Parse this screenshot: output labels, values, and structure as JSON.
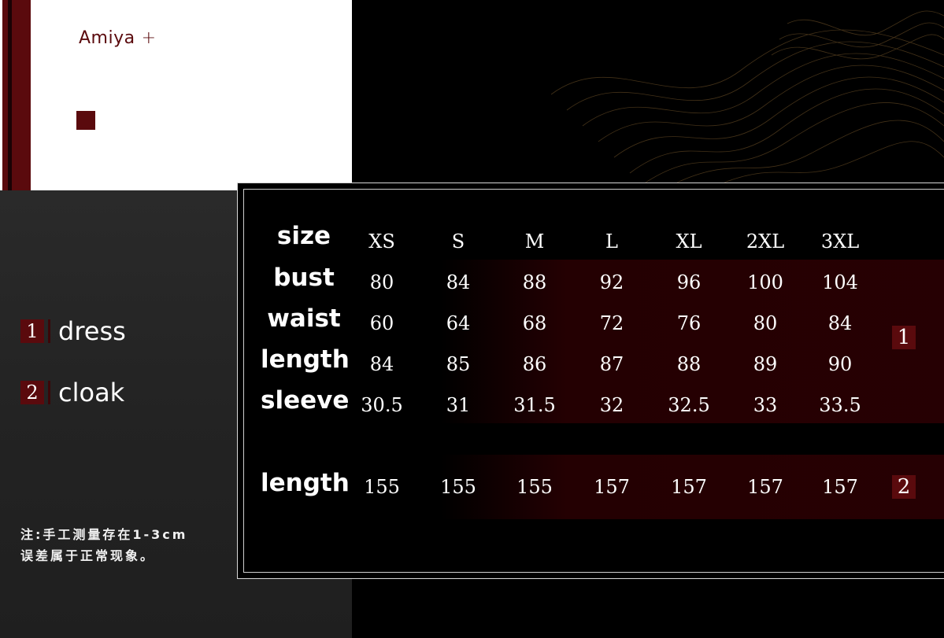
{
  "brand": {
    "name": "Amiya",
    "plus": "+"
  },
  "legend": [
    {
      "num": "1",
      "label": "dress"
    },
    {
      "num": "2",
      "label": "cloak"
    }
  ],
  "note": {
    "line1": "注:手工测量存在1-3cm",
    "line2": "误差属于正常现象。"
  },
  "table": {
    "header_label": "size",
    "sizes": [
      "XS",
      "S",
      "M",
      "L",
      "XL",
      "2XL",
      "3XL"
    ],
    "rows": [
      {
        "label": "bust",
        "values": [
          "80",
          "84",
          "88",
          "92",
          "96",
          "100",
          "104"
        ]
      },
      {
        "label": "waist",
        "values": [
          "60",
          "64",
          "68",
          "72",
          "76",
          "80",
          "84"
        ]
      },
      {
        "label": "length",
        "values": [
          "84",
          "85",
          "86",
          "87",
          "88",
          "89",
          "90"
        ]
      },
      {
        "label": "sleeve",
        "values": [
          "30.5",
          "31",
          "31.5",
          "32",
          "32.5",
          "33",
          "33.5"
        ]
      },
      {
        "label": "length",
        "values": [
          "155",
          "155",
          "155",
          "157",
          "157",
          "157",
          "157"
        ]
      }
    ],
    "group_markers": [
      "1",
      "2"
    ]
  },
  "colors": {
    "accent": "#5a0a0d",
    "background": "#000000",
    "panel_grey": "#232323"
  }
}
